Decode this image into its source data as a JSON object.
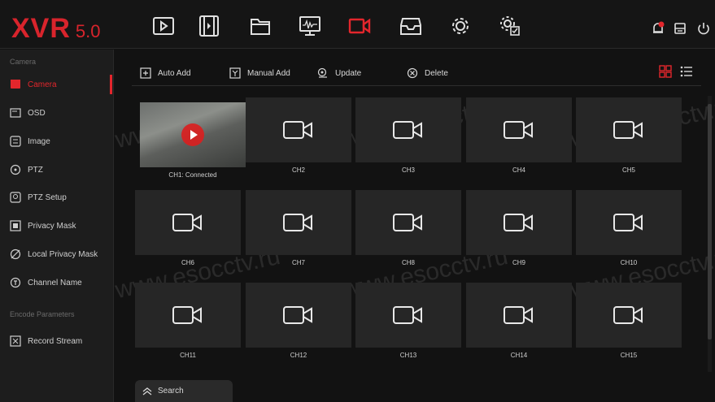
{
  "header": {
    "logo_brand": "XVR",
    "logo_version": "5.0",
    "nav_icons": [
      "playback-icon",
      "video-clip-icon",
      "folder-icon",
      "monitor-icon",
      "camera-icon",
      "storage-icon",
      "settings-gear-icon",
      "system-settings-icon"
    ],
    "active_nav": "camera-icon",
    "right_icons": [
      "alarm-bell-icon",
      "backup-icon",
      "power-icon"
    ]
  },
  "sidebar": {
    "section_camera": "Camera",
    "items": [
      {
        "label": "Camera",
        "icon": "camera-icon",
        "active": true
      },
      {
        "label": "OSD",
        "icon": "osd-icon"
      },
      {
        "label": "Image",
        "icon": "image-icon"
      },
      {
        "label": "PTZ",
        "icon": "ptz-icon"
      },
      {
        "label": "PTZ Setup",
        "icon": "ptz-setup-icon"
      },
      {
        "label": "Privacy Mask",
        "icon": "privacy-mask-icon"
      },
      {
        "label": "Local Privacy Mask",
        "icon": "local-privacy-mask-icon"
      },
      {
        "label": "Channel Name",
        "icon": "channel-name-icon"
      }
    ],
    "section_encode": "Encode Parameters",
    "encode_items": [
      {
        "label": "Record Stream",
        "icon": "record-stream-icon"
      }
    ]
  },
  "toolbar": {
    "auto_add": "Auto Add",
    "manual_add": "Manual Add",
    "update": "Update",
    "delete": "Delete"
  },
  "channels": [
    {
      "label": "CH1: Connected",
      "live": true
    },
    {
      "label": "CH2"
    },
    {
      "label": "CH3"
    },
    {
      "label": "CH4"
    },
    {
      "label": "CH5"
    },
    {
      "label": "CH6"
    },
    {
      "label": "CH7"
    },
    {
      "label": "CH8"
    },
    {
      "label": "CH9"
    },
    {
      "label": "CH10"
    },
    {
      "label": "CH11"
    },
    {
      "label": "CH12"
    },
    {
      "label": "CH13"
    },
    {
      "label": "CH14"
    },
    {
      "label": "CH15"
    }
  ],
  "footer": {
    "search_label": "Search"
  },
  "colors": {
    "accent": "#e3262c",
    "background": "#121212",
    "sidebar": "#1d1d1d",
    "tile": "#262626"
  }
}
